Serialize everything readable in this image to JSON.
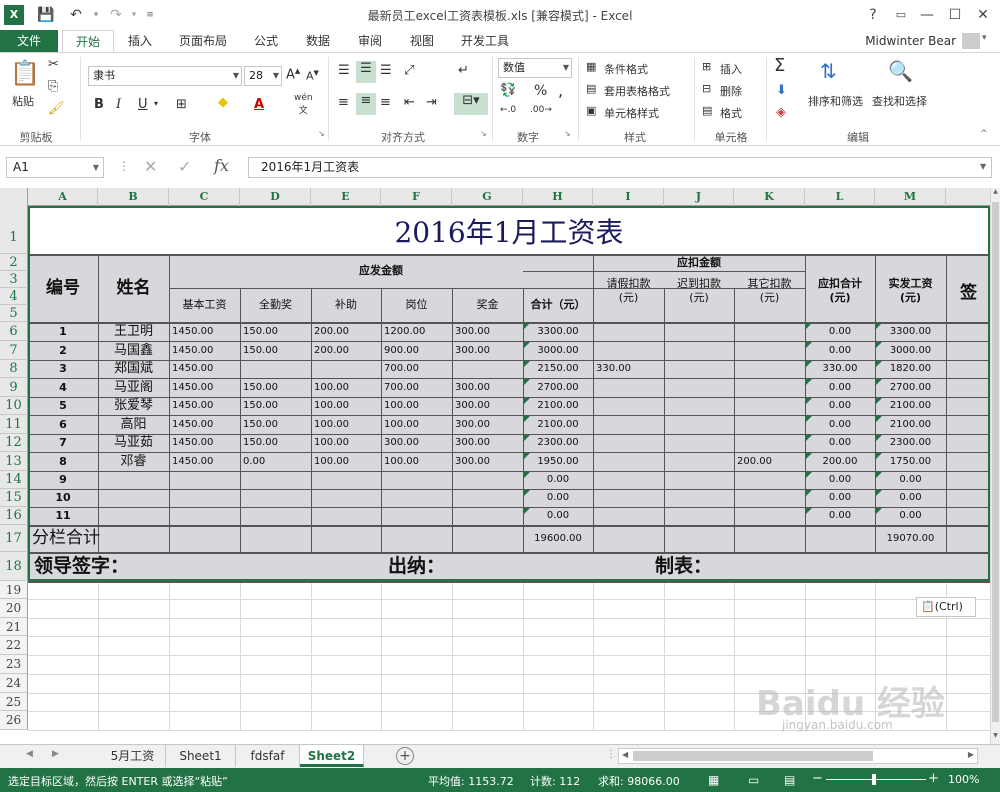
{
  "window": {
    "title": "最新员工excel工资表模板.xls  [兼容模式] - Excel",
    "help": "?",
    "restore": "▭",
    "minimize": "—",
    "maximize": "☐",
    "close": "✕"
  },
  "quick_access": {
    "app_icon": "excel-logo-icon",
    "save": "save-icon",
    "undo": "undo-icon",
    "redo": "redo-icon",
    "customize": "customize-icon"
  },
  "tabs": [
    "文件",
    "开始",
    "插入",
    "页面布局",
    "公式",
    "数据",
    "审阅",
    "视图",
    "开发工具"
  ],
  "active_tab": "开始",
  "user": "Midwinter Bear",
  "ribbon": {
    "clipboard": {
      "paste": "粘贴",
      "label": "剪贴板"
    },
    "font": {
      "name": "隶书",
      "size": "28",
      "bold": "B",
      "italic": "I",
      "underline": "U",
      "grow": "A",
      "shrink": "A",
      "label": "字体",
      "wen": "wén",
      "wen_char": "文"
    },
    "alignment": {
      "label": "对齐方式"
    },
    "number": {
      "format": "数值",
      "label": "数字",
      "percent": "%",
      "comma": ","
    },
    "styles": {
      "conditional": "条件格式",
      "table": "套用表格格式",
      "cell": "单元格样式",
      "label": "样式"
    },
    "cells": {
      "insert": "插入",
      "delete": "删除",
      "format": "格式",
      "label": "单元格"
    },
    "editing": {
      "sort": "排序和筛选",
      "find": "查找和选择",
      "label": "编辑",
      "sum": "Σ"
    }
  },
  "formula_bar": {
    "name_box": "A1",
    "formula": "2016年1月工资表",
    "fx": "fx",
    "cancel": "✕",
    "enter": "✓"
  },
  "columns": [
    "A",
    "B",
    "C",
    "D",
    "E",
    "F",
    "G",
    "H",
    "I",
    "J",
    "K",
    "L",
    "M"
  ],
  "rows": [
    "1",
    "2",
    "3",
    "4",
    "5",
    "6",
    "7",
    "8",
    "9",
    "10",
    "11",
    "12",
    "13",
    "14",
    "15",
    "16",
    "17",
    "18",
    "19",
    "20",
    "21",
    "22",
    "23",
    "24",
    "25",
    "26"
  ],
  "sheet": {
    "title": "2016年1月工资表",
    "header": {
      "no": "编号",
      "name": "姓名",
      "payable": "应发金额",
      "deduct": "应扣金额",
      "base": "基本工资",
      "attend": "全勤奖",
      "subsidy": "补助",
      "post": "岗位",
      "bonus": "奖金",
      "total": "合计（元）",
      "leave": "请假扣款",
      "leave_unit": "(元)",
      "late": "迟到扣款",
      "late_unit": "(元)",
      "other": "其它扣款",
      "other_unit": "(元)",
      "deduct_total": "应扣合计",
      "deduct_total_unit": "(元)",
      "net": "实发工资",
      "net_unit": "(元)",
      "sign": "签"
    },
    "data_rows": [
      [
        "1",
        "王卫明",
        "1450.00",
        "150.00",
        "200.00",
        "1200.00",
        "300.00",
        "3300.00",
        "",
        "",
        "",
        "0.00",
        "3300.00"
      ],
      [
        "2",
        "马国鑫",
        "1450.00",
        "150.00",
        "200.00",
        "900.00",
        "300.00",
        "3000.00",
        "",
        "",
        "",
        "0.00",
        "3000.00"
      ],
      [
        "3",
        "郑国斌",
        "1450.00",
        "",
        "",
        "700.00",
        "",
        "2150.00",
        "330.00",
        "",
        "",
        "330.00",
        "1820.00"
      ],
      [
        "4",
        "马亚阁",
        "1450.00",
        "150.00",
        "100.00",
        "700.00",
        "300.00",
        "2700.00",
        "",
        "",
        "",
        "0.00",
        "2700.00"
      ],
      [
        "5",
        "张爱琴",
        "1450.00",
        "150.00",
        "100.00",
        "100.00",
        "300.00",
        "2100.00",
        "",
        "",
        "",
        "0.00",
        "2100.00"
      ],
      [
        "6",
        "高阳",
        "1450.00",
        "150.00",
        "100.00",
        "100.00",
        "300.00",
        "2100.00",
        "",
        "",
        "",
        "0.00",
        "2100.00"
      ],
      [
        "7",
        "马亚茹",
        "1450.00",
        "150.00",
        "100.00",
        "300.00",
        "300.00",
        "2300.00",
        "",
        "",
        "",
        "0.00",
        "2300.00"
      ],
      [
        "8",
        "邓睿",
        "1450.00",
        "0.00",
        "100.00",
        "100.00",
        "300.00",
        "1950.00",
        "",
        "",
        "200.00",
        "200.00",
        "1750.00"
      ],
      [
        "9",
        "",
        "",
        "",
        "",
        "",
        "",
        "0.00",
        "",
        "",
        "",
        "0.00",
        "0.00"
      ],
      [
        "10",
        "",
        "",
        "",
        "",
        "",
        "",
        "0.00",
        "",
        "",
        "",
        "0.00",
        "0.00"
      ],
      [
        "11",
        "",
        "",
        "",
        "",
        "",
        "",
        "0.00",
        "",
        "",
        "",
        "0.00",
        "0.00"
      ]
    ],
    "subtotal_label": "分栏合计",
    "subtotal_total": "19600.00",
    "subtotal_net": "19070.00",
    "sign_leader": "领导签字：",
    "sign_cashier": "出纳：",
    "sign_maker": "制表：",
    "paste_options": "(Ctrl)"
  },
  "sheet_tabs": [
    "5月工资",
    "Sheet1",
    "fdsfaf",
    "Sheet2"
  ],
  "active_sheet": "Sheet2",
  "status": {
    "hint": "选定目标区域，然后按 ENTER 或选择“粘贴”",
    "average": "平均值: 1153.72",
    "count": "计数: 112",
    "sum": "求和: 98066.00",
    "zoom": "100%",
    "zoom_minus": "−",
    "zoom_plus": "+"
  },
  "watermark": "Baidu 经验",
  "watermark_url": "jingyan.baidu.com"
}
